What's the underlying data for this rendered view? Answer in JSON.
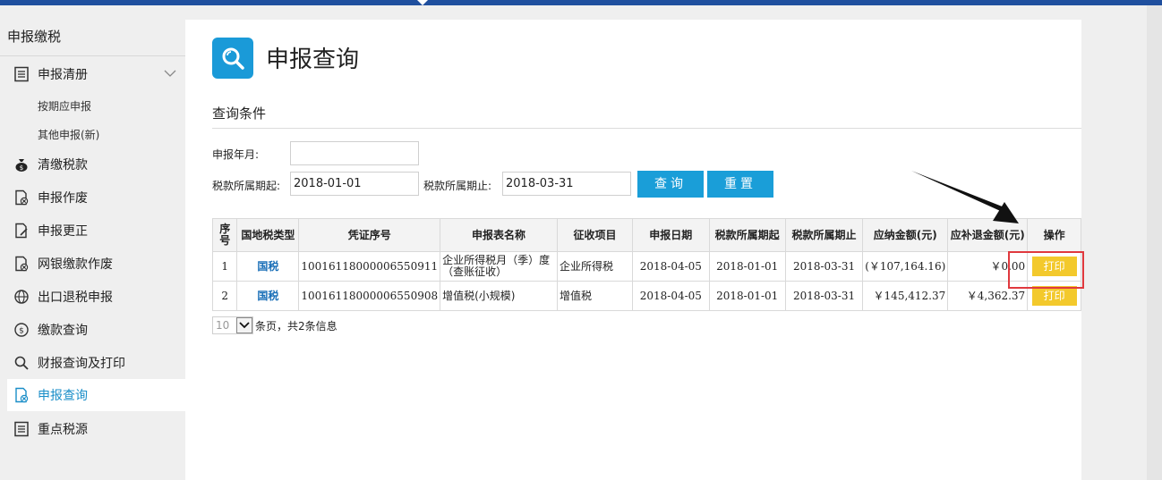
{
  "sidebar": {
    "title": "申报缴税",
    "items": [
      {
        "label": "申报清册",
        "icon": "list-doc-icon"
      },
      {
        "label": "清缴税款",
        "icon": "money-bag-icon"
      },
      {
        "label": "申报作废",
        "icon": "doc-cancel-icon"
      },
      {
        "label": "申报更正",
        "icon": "doc-edit-icon"
      },
      {
        "label": "网银缴款作废",
        "icon": "doc-cancel-icon"
      },
      {
        "label": "出口退税申报",
        "icon": "globe-icon"
      },
      {
        "label": "缴款查询",
        "icon": "dollar-circle-icon"
      },
      {
        "label": "财报查询及打印",
        "icon": "search-icon"
      },
      {
        "label": "申报查询",
        "icon": "doc-search-icon"
      },
      {
        "label": "重点税源",
        "icon": "list-doc-icon"
      }
    ],
    "subitems": [
      "按期应申报",
      "其他申报(新)"
    ]
  },
  "page": {
    "title": "申报查询",
    "section_title": "查询条件"
  },
  "form": {
    "year_month_label": "申报年月:",
    "year_month_value": "",
    "period_start_label": "税款所属期起:",
    "period_start_value": "2018-01-01",
    "period_end_label": "税款所属期止:",
    "period_end_value": "2018-03-31",
    "query_button": "查询",
    "reset_button": "重置"
  },
  "table": {
    "headers": [
      "序号",
      "国地税类型",
      "凭证序号",
      "申报表名称",
      "征收项目",
      "申报日期",
      "税款所属期起",
      "税款所属期止",
      "应纳金额(元)",
      "应补退金额(元)",
      "操作"
    ],
    "rows": [
      {
        "seq": "1",
        "type": "国税",
        "voucher": "10016118000006550911",
        "form_name": "企业所得税月（季）度（查账征收）",
        "item": "企业所得税",
        "date": "2018-04-05",
        "start": "2018-01-01",
        "end": "2018-03-31",
        "due": "(￥107,164.16)",
        "refund": "￥0.00",
        "action": "打印"
      },
      {
        "seq": "2",
        "type": "国税",
        "voucher": "10016118000006550908",
        "form_name": "增值税(小规模)",
        "item": "增值税",
        "date": "2018-04-05",
        "start": "2018-01-01",
        "end": "2018-03-31",
        "due": "￥145,412.37",
        "refund": "￥4,362.37",
        "action": "打印"
      }
    ]
  },
  "pager": {
    "page_size": "10",
    "summary": "条页，共2条信息"
  },
  "colors": {
    "accent": "#1a9ed8",
    "print_button": "#f3c92c",
    "highlight": "#e0393e",
    "topbar": "#1f4f9e"
  }
}
